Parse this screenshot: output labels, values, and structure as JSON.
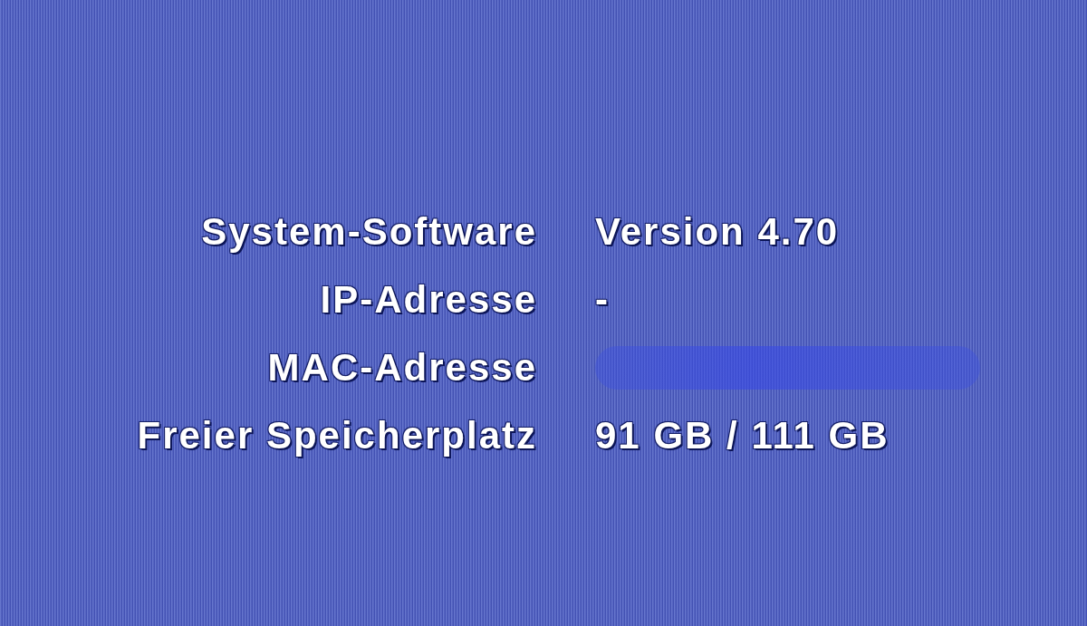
{
  "system_info": {
    "rows": [
      {
        "label": "System-Software",
        "value": "Version 4.70",
        "redacted": false
      },
      {
        "label": "IP-Adresse",
        "value": "-",
        "redacted": false
      },
      {
        "label": "MAC-Adresse",
        "redacted": true
      },
      {
        "label": "Freier Speicherplatz",
        "value": "91 GB / 111 GB",
        "redacted": false
      }
    ]
  }
}
